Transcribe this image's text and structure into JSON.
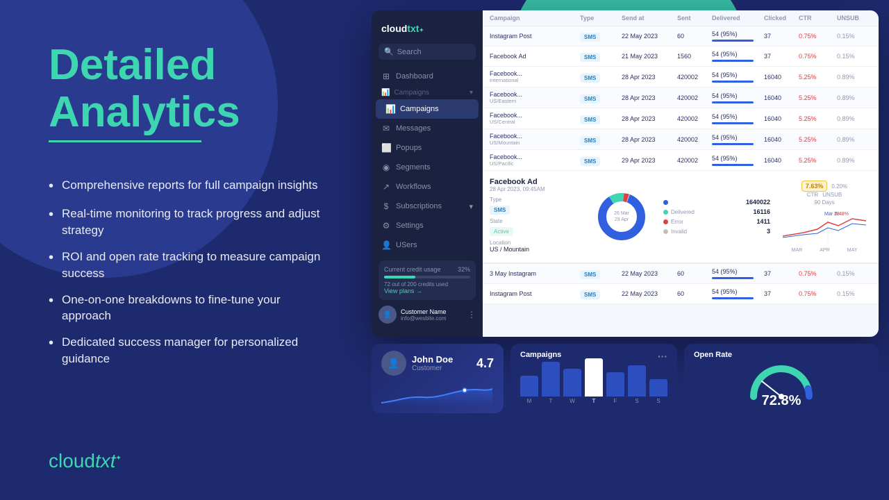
{
  "page": {
    "background": "#1e2a6e"
  },
  "headline": {
    "line1": "Detailed",
    "line2": "Analytics"
  },
  "features": [
    "Comprehensive reports for full campaign insights",
    "Real-time monitoring to track progress and adjust strategy",
    "ROI and open rate tracking to measure campaign success",
    "One-on-one breakdowns to fine-tune your approach",
    "Dedicated success manager for personalized guidance"
  ],
  "logo": {
    "text1": "cloud",
    "text2": "txt"
  },
  "sidebar": {
    "logo": "cloudtxt",
    "search_placeholder": "Search",
    "nav_items": [
      {
        "label": "Dashboard",
        "icon": "⊞",
        "active": false
      },
      {
        "label": "Campaigns",
        "icon": "📊",
        "active": true
      },
      {
        "label": "Campaigns",
        "icon": "📋",
        "active": false
      },
      {
        "label": "Messages",
        "icon": "✉",
        "active": false
      },
      {
        "label": "Popups",
        "icon": "⬜",
        "active": false
      },
      {
        "label": "Segments",
        "icon": "◉",
        "active": false
      },
      {
        "label": "Workflows",
        "icon": "↗",
        "active": false
      },
      {
        "label": "Subscriptions",
        "icon": "$",
        "active": false
      },
      {
        "label": "Settings",
        "icon": "⚙",
        "active": false
      },
      {
        "label": "USers",
        "icon": "👤",
        "active": false
      }
    ],
    "credit": {
      "label": "Current credit usage",
      "percent": "32%",
      "used": "72 out of 200 credits used",
      "link": "View plans →"
    },
    "user": {
      "name": "Customer Name",
      "email": "info@wesbite.com"
    }
  },
  "table": {
    "headers": [
      "Campaign",
      "Type",
      "Send at",
      "Sent",
      "Delivered",
      "Clicked",
      "CTR",
      "UNSUB"
    ],
    "rows": [
      {
        "campaign": "Instagram Post",
        "type": "SMS",
        "sendat": "22 May 2023",
        "sent": "60",
        "delivered": "54 (95%)",
        "clicked": "37",
        "ctr": "0.75%",
        "unsub": "0.15%"
      },
      {
        "campaign": "Facebook Ad",
        "sub": "",
        "type": "SMS",
        "sendat": "21 May 2023",
        "sent": "1560",
        "delivered": "54 (95%)",
        "clicked": "37",
        "ctr": "0.75%",
        "unsub": "0.15%"
      },
      {
        "campaign": "Facebook...",
        "sub": "International",
        "type": "SMS",
        "sendat": "28 Apr 2023",
        "sent": "420002",
        "delivered": "54 (95%)",
        "clicked": "16040",
        "ctr": "5.25%",
        "unsub": "0.89%"
      },
      {
        "campaign": "Facebook...",
        "sub": "US/Eastern",
        "type": "SMS",
        "sendat": "28 Apr 2023",
        "sent": "420002",
        "delivered": "54 (95%)",
        "clicked": "16040",
        "ctr": "5.25%",
        "unsub": "0.89%"
      },
      {
        "campaign": "Facebook...",
        "sub": "US/Central",
        "type": "SMS",
        "sendat": "28 Apr 2023",
        "sent": "420002",
        "delivered": "54 (95%)",
        "clicked": "16040",
        "ctr": "5.25%",
        "unsub": "0.89%"
      },
      {
        "campaign": "Facebook...",
        "sub": "US/Mountain",
        "type": "SMS",
        "sendat": "28 Apr 2023",
        "sent": "420002",
        "delivered": "54 (95%)",
        "clicked": "16040",
        "ctr": "5.25%",
        "unsub": "0.89%"
      },
      {
        "campaign": "Facebook...",
        "sub": "US/Pacific",
        "type": "SMS",
        "sendat": "29 Apr 2023",
        "sent": "420002",
        "delivered": "54 (95%)",
        "clicked": "16040",
        "ctr": "5.25%",
        "unsub": "0.89%"
      }
    ],
    "expanded": {
      "title": "Facebook Ad",
      "date": "28 Apr 2023, 09:45AM",
      "type": "SMS",
      "state": "Active",
      "location": "US / Mountain",
      "stats": [
        {
          "label": "1640022",
          "color": "#3060e0",
          "sub": ""
        },
        {
          "label": "16116",
          "color": "#3dd6b0",
          "sub": "Delivered"
        },
        {
          "label": "1411",
          "color": "#e04040",
          "sub": "Error"
        },
        {
          "label": "3",
          "color": "#c0c0c0",
          "sub": "Invalid"
        }
      ],
      "ctr": "7.63%",
      "ctr_label": "CTR",
      "unsub": "0.20%",
      "unsub_label": "UNSUB",
      "days": "90 Days",
      "chart_labels": [
        "MAR",
        "APR",
        "MAY"
      ],
      "chart_date": "Mar 28",
      "chart_val": "6.48%"
    },
    "rows2": [
      {
        "campaign": "3 May Instagram",
        "type": "SMS",
        "sendat": "22 May 2023",
        "sent": "60",
        "delivered": "54 (95%)",
        "clicked": "37",
        "ctr": "0.75%",
        "unsub": "0.15%"
      },
      {
        "campaign": "Instagram Post",
        "type": "SMS",
        "sendat": "22 May 2023",
        "sent": "60",
        "delivered": "54 (95%)",
        "clicked": "37",
        "ctr": "0.75%",
        "unsub": "0.15%"
      }
    ]
  },
  "bottom_cards": {
    "user_card": {
      "name": "John Doe",
      "role": "Customer",
      "rating": "4.7"
    },
    "campaigns_card": {
      "title": "Campaigns",
      "bars": [
        {
          "label": "M",
          "height": 30,
          "color": "#3060e0"
        },
        {
          "label": "T",
          "height": 50,
          "color": "#3060e0"
        },
        {
          "label": "W",
          "height": 40,
          "color": "#3060e0"
        },
        {
          "label": "T",
          "height": 55,
          "color": "#ffffff"
        },
        {
          "label": "F",
          "height": 35,
          "color": "#3060e0"
        },
        {
          "label": "S",
          "height": 45,
          "color": "#3060e0"
        },
        {
          "label": "S",
          "height": 25,
          "color": "#3060e0"
        }
      ]
    },
    "openrate_card": {
      "title": "Open Rate",
      "value": "72.8%"
    }
  }
}
